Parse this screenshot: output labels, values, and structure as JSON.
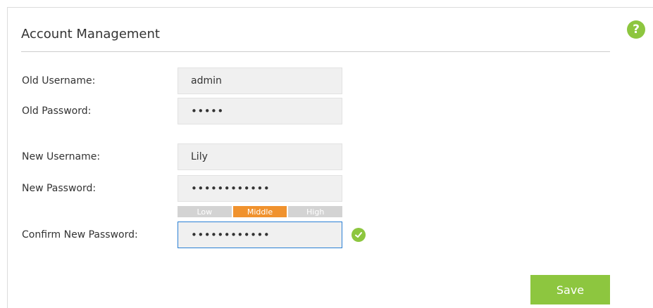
{
  "header": {
    "title": "Account Management",
    "help_icon": "question-mark-icon",
    "help_glyph": "?"
  },
  "form": {
    "old_username": {
      "label": "Old Username:",
      "value": "admin"
    },
    "old_password": {
      "label": "Old Password:",
      "value": "•••••"
    },
    "new_username": {
      "label": "New Username:",
      "value": "Lily"
    },
    "new_password": {
      "label": "New Password:",
      "value": "••••••••••••"
    },
    "strength": {
      "levels": [
        "Low",
        "Middle",
        "High"
      ],
      "selected": "Middle",
      "active_color": "#f0922e",
      "inactive_color": "#d3d3d3"
    },
    "confirm_password": {
      "label": "Confirm New Password:",
      "value": "••••••••••••",
      "valid_icon": "check-circle-icon"
    }
  },
  "actions": {
    "save_label": "Save"
  },
  "colors": {
    "accent": "#8dc63f",
    "focus_border": "#2a7fd4",
    "field_bg": "#f0f0f0"
  }
}
